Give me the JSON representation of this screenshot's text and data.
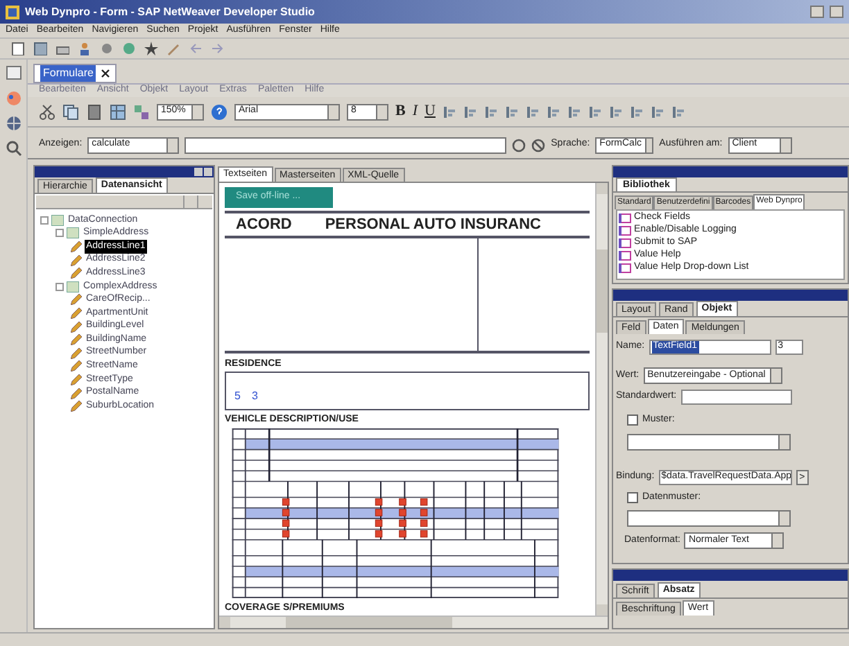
{
  "window": {
    "title": "Web Dynpro - Form - SAP NetWeaver Developer Studio"
  },
  "menu_bar": [
    "Datei",
    "Bearbeiten",
    "Navigieren",
    "Suchen",
    "Projekt",
    "Ausführen",
    "Fenster",
    "Hilfe"
  ],
  "editor_tab": {
    "label": "Formulare"
  },
  "editor_menu": [
    {
      "label": "Bearbeiten",
      "disabled": true
    },
    {
      "label": "Ansicht",
      "disabled": true
    },
    {
      "label": "Objekt",
      "disabled": true
    },
    {
      "label": "Layout",
      "disabled": true
    },
    {
      "label": "Extras",
      "disabled": true
    },
    {
      "label": "Paletten",
      "disabled": true
    },
    {
      "label": "Hilfe",
      "disabled": true
    }
  ],
  "format_toolbar": {
    "zoom": "150%",
    "font": "Arial",
    "font_size": "8",
    "bold": "B",
    "italic": "I",
    "underline": "U"
  },
  "script_bar": {
    "show_label": "Anzeigen:",
    "show_value": "calculate",
    "language_label": "Sprache:",
    "language_value": "FormCalc",
    "run_at_label": "Ausführen am:",
    "run_at_value": "Client"
  },
  "data_panel": {
    "tabs": [
      {
        "label": "Hierarchie",
        "selected": false
      },
      {
        "label": "Datenansicht",
        "selected": true
      }
    ],
    "tree": [
      {
        "label": "DataConnection",
        "selected": false,
        "expanded": true,
        "children": [
          {
            "label": "SimpleAddress",
            "selected": false,
            "expanded": true,
            "children": [
              {
                "label": "AddressLine1",
                "selected": true
              },
              {
                "label": "AddressLine2",
                "selected": false
              },
              {
                "label": "AddressLine3",
                "selected": false
              }
            ]
          },
          {
            "label": "ComplexAddress",
            "selected": false,
            "expanded": true,
            "children": [
              {
                "label": "CareOfRecip...",
                "selected": false
              },
              {
                "label": "ApartmentUnit",
                "selected": false
              },
              {
                "label": "BuildingLevel",
                "selected": false
              },
              {
                "label": "BuildingName",
                "selected": false
              },
              {
                "label": "StreetNumber",
                "selected": false
              },
              {
                "label": "StreetName",
                "selected": false
              },
              {
                "label": "StreetType",
                "selected": false
              },
              {
                "label": "PostalName",
                "selected": false
              },
              {
                "label": "SuburbLocation",
                "selected": false
              }
            ]
          }
        ]
      }
    ]
  },
  "design_tabs": [
    {
      "label": "Textseiten",
      "selected": true
    },
    {
      "label": "Masterseiten",
      "selected": false
    },
    {
      "label": "XML-Quelle",
      "selected": false
    }
  ],
  "form": {
    "save_button": "Save off-line ...",
    "logo": "ACORD",
    "title": "PERSONAL AUTO INSURANC",
    "residence": "RESIDENCE",
    "residence_values": [
      "5",
      "3"
    ],
    "vehicle": "VEHICLE DESCRIPTION/USE",
    "coverages": "COVERAGE S/PREMIUMS"
  },
  "library": {
    "title": "Bibliothek",
    "tabs": [
      {
        "label": "Standard",
        "selected": false
      },
      {
        "label": "Benutzerdefini",
        "selected": false
      },
      {
        "label": "Barcodes",
        "selected": false
      },
      {
        "label": "Web Dynpro",
        "selected": true
      }
    ],
    "items": [
      {
        "label": "Check Fields"
      },
      {
        "label": "Enable/Disable Logging"
      },
      {
        "label": "Submit to SAP"
      },
      {
        "label": "Value Help"
      },
      {
        "label": "Value Help Drop-down List"
      }
    ]
  },
  "object_panel": {
    "tabs": [
      {
        "label": "Layout",
        "selected": false
      },
      {
        "label": "Rand",
        "selected": false
      },
      {
        "label": "Objekt",
        "selected": true
      }
    ],
    "subtabs": [
      {
        "label": "Feld",
        "selected": false
      },
      {
        "label": "Daten",
        "selected": true
      },
      {
        "label": "Meldungen",
        "selected": false
      }
    ],
    "name_label": "Name:",
    "name_value": "TextField1",
    "name_index": "3",
    "value_label": "Wert:",
    "value_value": "Benutzereingabe - Optional",
    "default_label": "Standardwert:",
    "pattern": {
      "label": "Muster:",
      "checked": false
    },
    "binding_label": "Bindung:",
    "binding_value": "$data.TravelRequestData.App",
    "binding_button": ">",
    "data_pattern": {
      "label": "Datenmuster:",
      "checked": false
    },
    "format_label": "Datenformat:",
    "format_value": "Normaler Text"
  },
  "paragraph_panel": {
    "tabs": [
      {
        "label": "Schrift",
        "selected": false
      },
      {
        "label": "Absatz",
        "selected": true
      }
    ],
    "subtabs": [
      {
        "label": "Beschriftung",
        "selected": false
      },
      {
        "label": "Wert",
        "selected": true
      }
    ]
  }
}
